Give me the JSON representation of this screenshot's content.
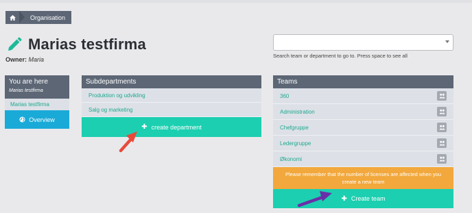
{
  "breadcrumb": {
    "home_icon": "home-icon",
    "current": "Organisation"
  },
  "page": {
    "title": "Marias testfirma",
    "owner_label": "Owner:",
    "owner_name": "Maria"
  },
  "search": {
    "value": "",
    "hint": "Search team or department to go to. Press space to see all"
  },
  "you_are_here": {
    "heading": "You are here",
    "current": "Marias testfirma",
    "link": "Marias testfirma",
    "overview_label": "Overview"
  },
  "subdepartments": {
    "heading": "Subdepartments",
    "items": [
      "Produktion og udvikling",
      "Salg og marketing"
    ],
    "create_label": "create department"
  },
  "teams": {
    "heading": "Teams",
    "items": [
      "360",
      "Administration",
      "Chefgruppe",
      "Ledergruppe",
      "Økonomi"
    ],
    "notice": "Please remember that the number of licenses are affected when you create a new team",
    "create_label": "Create team"
  },
  "colors": {
    "header": "#5c6675",
    "accent_green": "#1ccfb0",
    "link_green": "#1fa88e",
    "overview_blue": "#1aaad8",
    "notice_orange": "#f2a83c",
    "arrow_red": "#e8493c",
    "arrow_purple": "#6a2fa8"
  }
}
